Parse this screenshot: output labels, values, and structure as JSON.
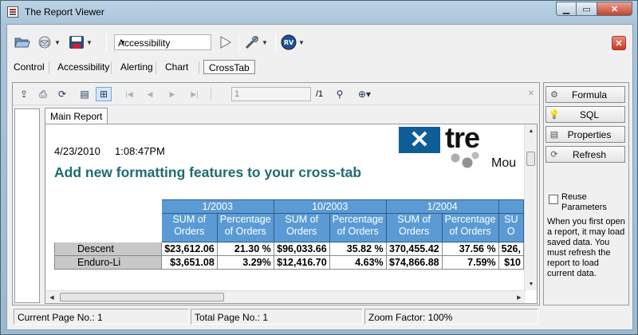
{
  "window": {
    "title": "The Report Viewer"
  },
  "toolbar": {
    "combo_value": "Accessibility",
    "icons": [
      "open-folder-icon",
      "email-icon",
      "save-icon",
      "play-icon",
      "tools-icon",
      "report-viewer-logo-icon"
    ]
  },
  "tabs": [
    "Control",
    "Accessibility",
    "Alerting",
    "Chart",
    "CrossTab"
  ],
  "report_toolbar": {
    "page_input": "1",
    "page_count": "/1"
  },
  "main_tab": "Main Report",
  "report": {
    "date": "4/23/2010",
    "time": "1:08:47PM",
    "title": "Add new formatting features to your cross-tab",
    "logo_word": "tre",
    "logo_sub": "Mou",
    "periods": [
      "1/2003",
      "10/2003",
      "1/2004",
      ""
    ],
    "col_headers": [
      "SUM of Orders",
      "Percentage of Orders",
      "SUM of Orders",
      "Percentage of Orders",
      "SUM of Orders",
      "Percentage of Orders",
      "SU O"
    ],
    "rows": [
      {
        "label": "Descent",
        "values": [
          "$23,612.06",
          "21.30 %",
          "$96,033.66",
          "35.82 %",
          "370,455.42",
          "37.56 %",
          "526,"
        ]
      },
      {
        "label": "Enduro-Li",
        "values": [
          "$3,651.08",
          "3.29%",
          "$12,416.70",
          "4.63%",
          "$74,866.88",
          "7.59%",
          "$10"
        ]
      }
    ]
  },
  "side_panel": {
    "buttons": [
      "Formula",
      "SQL",
      "Properties",
      "Refresh"
    ],
    "checkbox_label": "Reuse Parameters",
    "info": "When you first open a report, it may load saved data.  You must refresh the report to load current data."
  },
  "status": {
    "current_page": "Current Page No.: 1",
    "total_page": "Total Page No.: 1",
    "zoom": "Zoom Factor: 100%"
  },
  "colors": {
    "header_blue": "#5b9bd5",
    "title_teal": "#1d6b70",
    "logo_blue": "#0f5d97"
  }
}
